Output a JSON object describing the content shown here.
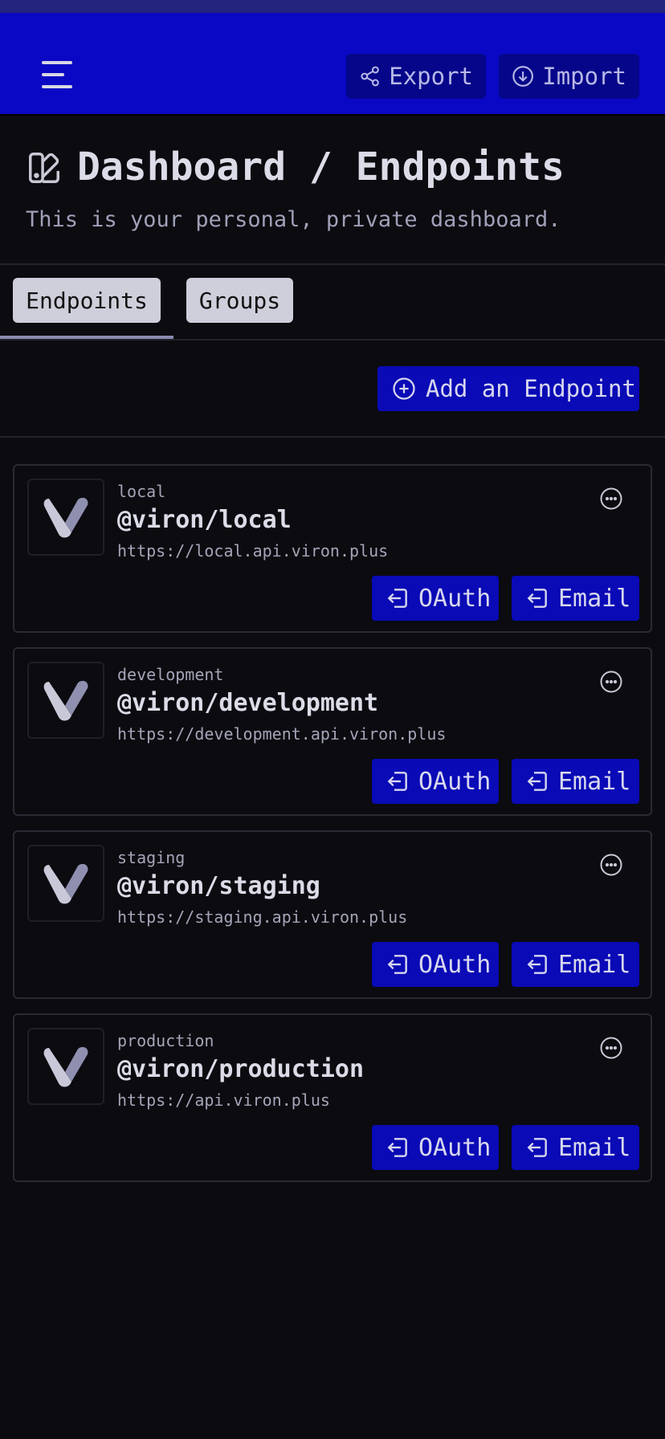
{
  "header": {
    "menu_icon": "hamburger-menu-icon",
    "export_label": "Export",
    "export_icon": "share-nodes-icon",
    "import_label": "Import",
    "import_icon": "download-circle-icon"
  },
  "page": {
    "title_icon": "swatch-book-icon",
    "title": "Dashboard / Endpoints",
    "subtitle": "This is your personal, private dashboard."
  },
  "tabs": [
    {
      "label": "Endpoints",
      "active": true
    },
    {
      "label": "Groups",
      "active": false
    }
  ],
  "add_endpoint": {
    "label": "Add an Endpoint",
    "icon": "plus-circle-icon"
  },
  "endpoints": [
    {
      "label": "local",
      "name": "@viron/local",
      "url": "https://local.api.viron.plus",
      "oauth": "OAuth",
      "email": "Email"
    },
    {
      "label": "development",
      "name": "@viron/development",
      "url": "https://development.api.viron.plus",
      "oauth": "OAuth",
      "email": "Email"
    },
    {
      "label": "staging",
      "name": "@viron/staging",
      "url": "https://staging.api.viron.plus",
      "oauth": "OAuth",
      "email": "Email"
    },
    {
      "label": "production",
      "name": "@viron/production",
      "url": "https://api.viron.plus",
      "oauth": "OAuth",
      "email": "Email"
    }
  ],
  "colors": {
    "header_bg": "#0a08c4",
    "button_bg": "#0a0ab6",
    "page_bg": "#0b0b10",
    "tab_bg": "#cfcfdc"
  }
}
